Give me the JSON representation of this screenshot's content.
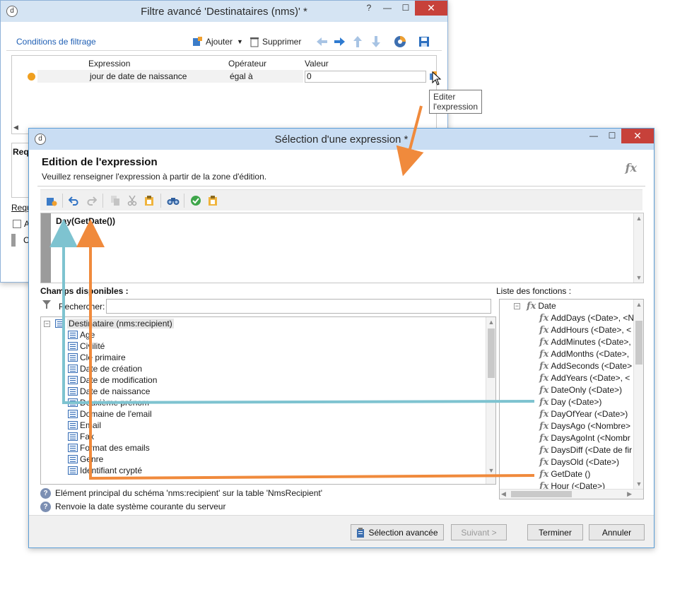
{
  "filter_window": {
    "title": "Filtre avancé 'Destinataires (nms)' *",
    "toolbar": {
      "section_title": "Conditions de filtrage",
      "add_label": "Ajouter",
      "delete_label": "Supprimer"
    },
    "grid": {
      "headers": {
        "expression": "Expression",
        "operator": "Opérateur",
        "value": "Valeur"
      },
      "row": {
        "expression": "jour de date de naissance",
        "operator": "égal à",
        "value": "0"
      }
    },
    "partial_labels": {
      "req_label": "Requ",
      "req_link": "Requ",
      "checkbox_letter": "A",
      "tab_letter": "C"
    },
    "tooltip": "Editer l'expression"
  },
  "expr_window": {
    "title": "Sélection d'une expression *",
    "heading": "Edition de l'expression",
    "subheading": "Veuillez renseigner l'expression à partir de la zone d'édition.",
    "fx_logo": "fx",
    "code": "Day(GetDate())",
    "fields_label": "Champs disponibles :",
    "search_label": "Rechercher:",
    "search_value": "",
    "functions_label": "Liste des fonctions :",
    "tree": {
      "root": "Destinataire (nms:recipient)",
      "items": [
        "Age",
        "Civilité",
        "Clé primaire",
        "Date de création",
        "Date de modification",
        "Date de naissance",
        "Deuxième prénom",
        "Domaine de l'email",
        "Email",
        "Fax",
        "Format des emails",
        "Genre",
        "Identifiant crypté"
      ]
    },
    "functions": {
      "group": "Date",
      "items": [
        "AddDays (<Date>, <N",
        "AddHours (<Date>, <",
        "AddMinutes (<Date>,",
        "AddMonths (<Date>,",
        "AddSeconds (<Date>",
        "AddYears (<Date>, <",
        "DateOnly (<Date>)",
        "Day (<Date>)",
        "DayOfYear (<Date>)",
        "DaysAgo (<Nombre>",
        "DaysAgoInt (<Nombr",
        "DaysDiff (<Date de fir",
        "DaysOld (<Date>)",
        "GetDate ()",
        "Hour (<Date>)"
      ]
    },
    "info1": "Elément principal du schéma 'nms:recipient' sur la table 'NmsRecipient'",
    "info2": "Renvoie la date système courante du serveur",
    "buttons": {
      "advanced": "Sélection avancée",
      "next": "Suivant >",
      "finish": "Terminer",
      "cancel": "Annuler"
    }
  },
  "colors": {
    "title_bg": "#d5e4f3",
    "close_red": "#c7413a",
    "annotation_orange": "#f08a3c",
    "annotation_teal": "#7ec3d0",
    "link_blue": "#1f5fb4"
  }
}
